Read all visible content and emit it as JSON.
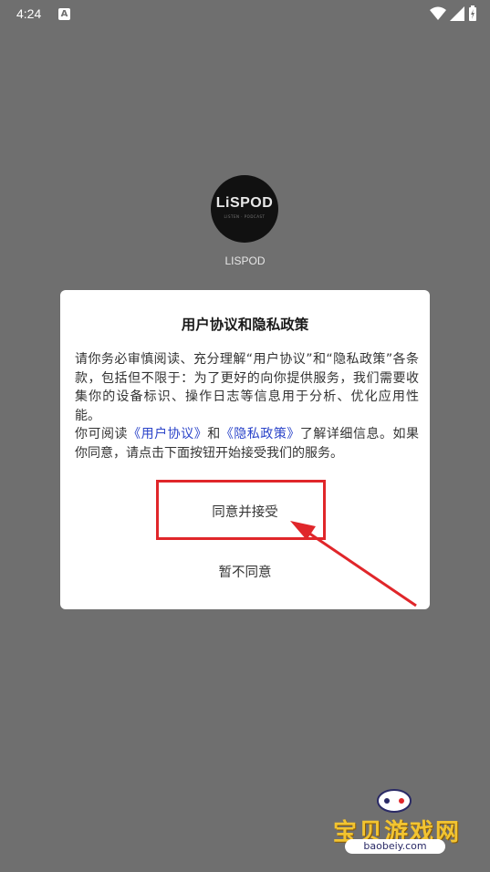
{
  "status_bar": {
    "time": "4:24",
    "notification_icon": "A"
  },
  "app": {
    "logo_text": "LiSPOD",
    "logo_subtext": "LISTEN · PODCAST",
    "name": "LISPOD"
  },
  "dialog": {
    "title": "用户协议和隐私政策",
    "body_p1": "请你务必审慎阅读、充分理解“用户协议”和“隐私政策”各条款，包括但不限于：为了更好的向你提供服务，我们需要收集你的设备标识、操作日志等信息用于分析、优化应用性能。",
    "body_p2_prefix": "你可阅读",
    "link_user_agreement": "《用户协议》",
    "body_p2_and": "和",
    "link_privacy_policy": "《隐私政策》",
    "body_p2_suffix": "了解详细信息。如果你同意，请点击下面按钮开始接受我们的服务。",
    "accept_button": "同意并接受",
    "decline_button": "暂不同意"
  },
  "watermark": {
    "title": "宝贝游戏网",
    "url": "baobeiy.com"
  },
  "colors": {
    "overlay": "#6f6f6f",
    "link": "#2b44c9",
    "annotation": "#e0262a"
  }
}
